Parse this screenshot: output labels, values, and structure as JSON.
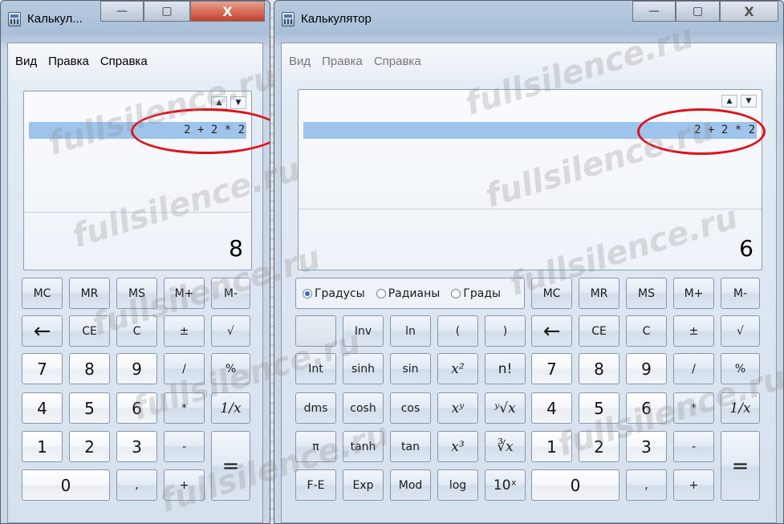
{
  "left_window": {
    "title": "Калькул...",
    "caption": {
      "minimize": "—",
      "maximize": "▢",
      "close": "X"
    },
    "menu": [
      "Вид",
      "Правка",
      "Справка"
    ],
    "history_expression": "2 + 2 * 2",
    "result": "8",
    "buttons": {
      "mc": "MC",
      "mr": "MR",
      "ms": "MS",
      "mplus": "M+",
      "mminus": "M-",
      "back": "←",
      "ce": "CE",
      "c": "C",
      "plusminus": "±",
      "sqrt": "√",
      "n7": "7",
      "n8": "8",
      "n9": "9",
      "div": "/",
      "pct": "%",
      "n4": "4",
      "n5": "5",
      "n6": "6",
      "mul": "*",
      "recip": "1/x",
      "n1": "1",
      "n2": "2",
      "n3": "3",
      "minus": "-",
      "eq": "=",
      "n0": "0",
      "comma": ",",
      "plus": "+"
    }
  },
  "right_window": {
    "title": "Калькулятор",
    "caption": {
      "minimize": "—",
      "maximize": "▢",
      "close": "X"
    },
    "menu": [
      "Вид",
      "Правка",
      "Справка"
    ],
    "history_expression": "2 + 2 * 2",
    "result": "6",
    "angle_units": [
      "Градусы",
      "Радианы",
      "Грады"
    ],
    "angle_selected": "Градусы",
    "buttons": {
      "mc": "MC",
      "mr": "MR",
      "ms": "MS",
      "mplus": "M+",
      "mminus": "M-",
      "blank": "",
      "inv": "Inv",
      "ln": "ln",
      "lparen": "(",
      "rparen": ")",
      "back": "←",
      "ce": "CE",
      "c": "C",
      "plusminus": "±",
      "sqrt": "√",
      "int": "Int",
      "sinh": "sinh",
      "sin": "sin",
      "x2": "x²",
      "fact": "n!",
      "n7": "7",
      "n8": "8",
      "n9": "9",
      "div": "/",
      "pct": "%",
      "dms": "dms",
      "cosh": "cosh",
      "cos": "cos",
      "xy": "xʸ",
      "yroot": "ʸ√x",
      "n4": "4",
      "n5": "5",
      "n6": "6",
      "mul": "*",
      "recip": "1/x",
      "pi": "π",
      "tanh": "tanh",
      "tan": "tan",
      "x3": "x³",
      "cuberoot": "∛x",
      "n1": "1",
      "n2": "2",
      "n3": "3",
      "minus": "-",
      "eq": "=",
      "fe": "F-E",
      "exp": "Exp",
      "mod": "Mod",
      "log": "log",
      "tenx": "10ˣ",
      "n0": "0",
      "comma": ",",
      "plus": "+"
    }
  },
  "watermark": "fullsilence.ru",
  "colors": {
    "highlight_oval": "#e0101a",
    "history_selection": "#9ec4ec"
  }
}
